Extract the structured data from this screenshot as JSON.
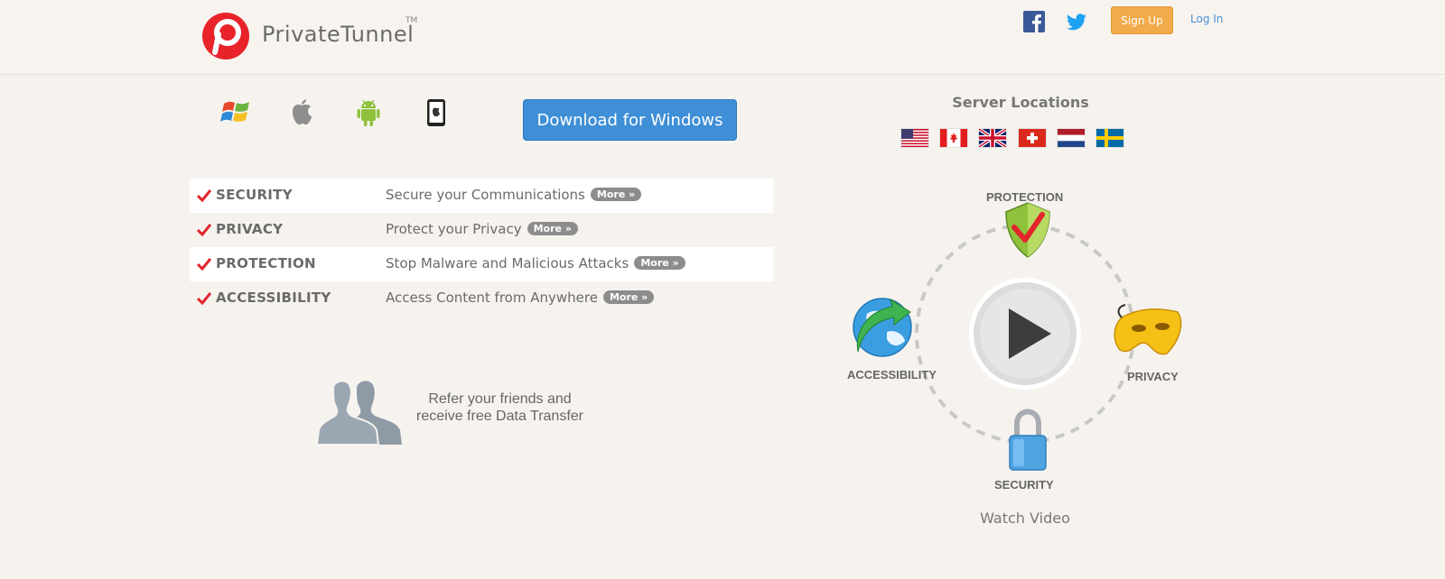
{
  "header": {
    "brand": "PrivateTunnel",
    "trademark": "TM",
    "signup_label": "Sign Up",
    "login_label": "Log In",
    "social": [
      "facebook-icon",
      "twitter-icon"
    ]
  },
  "platforms": [
    "windows-icon",
    "apple-icon",
    "android-icon",
    "ipad-icon"
  ],
  "download_label": "Download for Windows",
  "features": [
    {
      "name": "SECURITY",
      "desc": "Secure your Communications",
      "more": "More »"
    },
    {
      "name": "PRIVACY",
      "desc": "Protect your Privacy",
      "more": "More »"
    },
    {
      "name": "PROTECTION",
      "desc": "Stop Malware and Malicious Attacks",
      "more": "More »"
    },
    {
      "name": "ACCESSIBILITY",
      "desc": "Access Content from Anywhere",
      "more": "More »"
    }
  ],
  "refer": {
    "line1": "Refer your friends and",
    "line2": "receive free Data Transfer"
  },
  "server": {
    "title": "Server Locations",
    "flags": [
      "us-flag",
      "canada-flag",
      "uk-flag",
      "switzerland-flag",
      "netherlands-flag",
      "sweden-flag"
    ]
  },
  "wheel": {
    "protection": "PROTECTION",
    "privacy": "PRIVACY",
    "security": "SECURITY",
    "accessibility": "ACCESSIBILITY",
    "watch": "Watch Video"
  },
  "colors": {
    "accent_blue": "#3f8fd7",
    "signup_orange": "#f2ab4a",
    "check_red": "#e2242b",
    "logo_red": "#e8232a"
  }
}
